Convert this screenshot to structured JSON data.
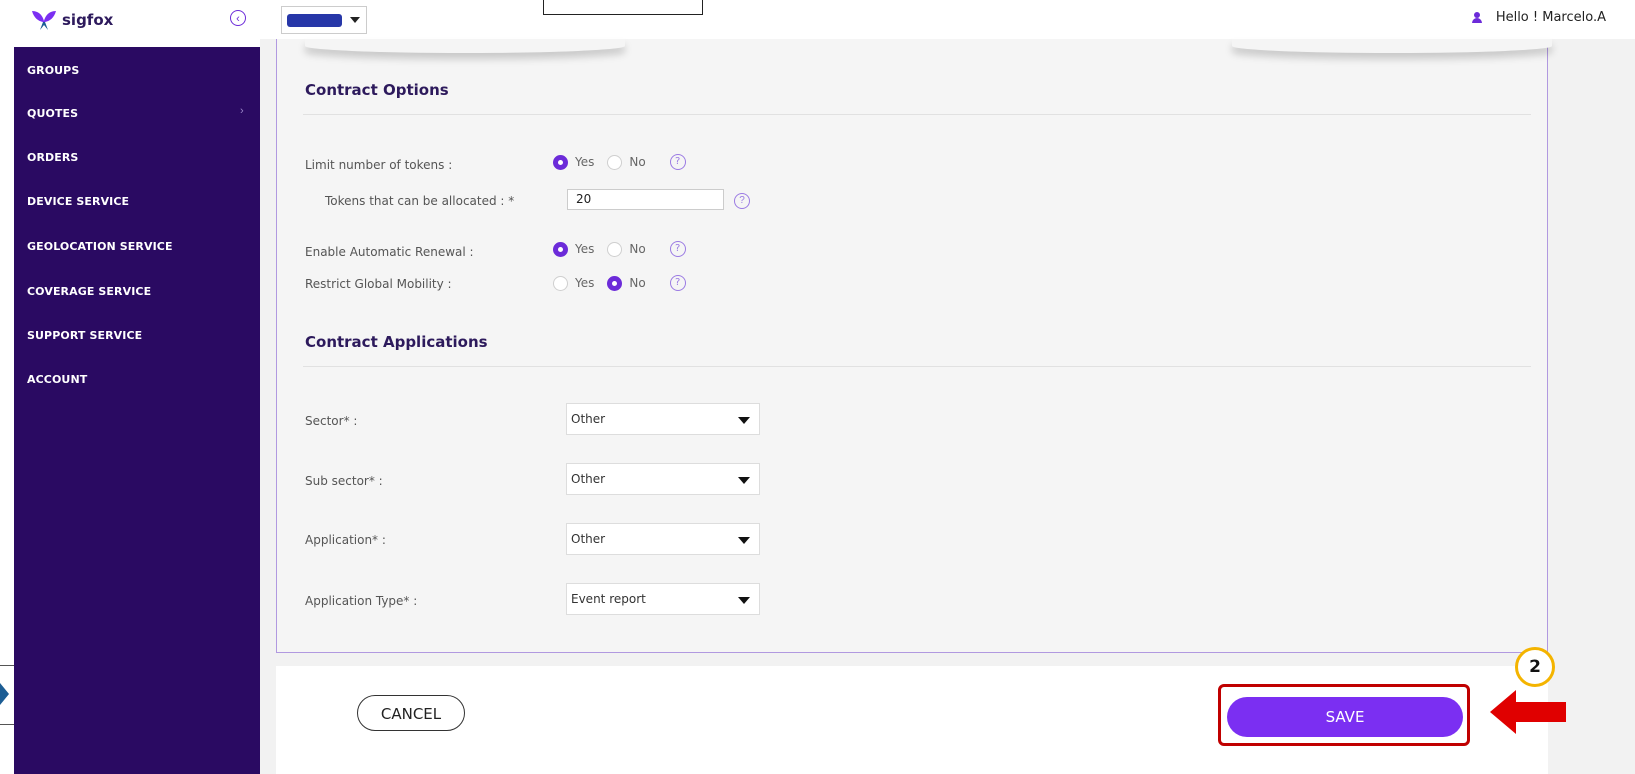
{
  "header": {
    "brand": "sigfox",
    "user_greeting": "Hello ! Marcelo.A"
  },
  "sidebar": {
    "items": [
      {
        "label": "GROUPS"
      },
      {
        "label": "QUOTES"
      },
      {
        "label": "ORDERS"
      },
      {
        "label": "DEVICE SERVICE"
      },
      {
        "label": "GEOLOCATION SERVICE"
      },
      {
        "label": "COVERAGE SERVICE"
      },
      {
        "label": "SUPPORT SERVICE"
      },
      {
        "label": "ACCOUNT"
      }
    ]
  },
  "contract_options": {
    "title": "Contract Options",
    "limit_tokens": {
      "label": "Limit number of tokens :",
      "selected": "Yes"
    },
    "tokens_allocated": {
      "label": "Tokens that can be allocated : *",
      "value": "20"
    },
    "auto_renewal": {
      "label": "Enable Automatic Renewal :",
      "selected": "Yes"
    },
    "global_mobility": {
      "label": "Restrict Global Mobility :",
      "selected": "No"
    },
    "yes_label": "Yes",
    "no_label": "No"
  },
  "contract_applications": {
    "title": "Contract Applications",
    "sector": {
      "label": "Sector* :",
      "value": "Other"
    },
    "sub_sector": {
      "label": "Sub sector* :",
      "value": "Other"
    },
    "application": {
      "label": "Application* :",
      "value": "Other"
    },
    "application_type": {
      "label": "Application Type* :",
      "value": "Event report"
    }
  },
  "footer": {
    "cancel_label": "CANCEL",
    "save_label": "SAVE"
  },
  "annotation": {
    "step_number": "2",
    "highlight_color": "#c00000",
    "badge_color": "#f4b400",
    "arrow_color": "#e00000"
  },
  "colors": {
    "sidebar_bg": "#2a0a62",
    "accent": "#7b2ff2",
    "heading": "#2d1a5c"
  }
}
